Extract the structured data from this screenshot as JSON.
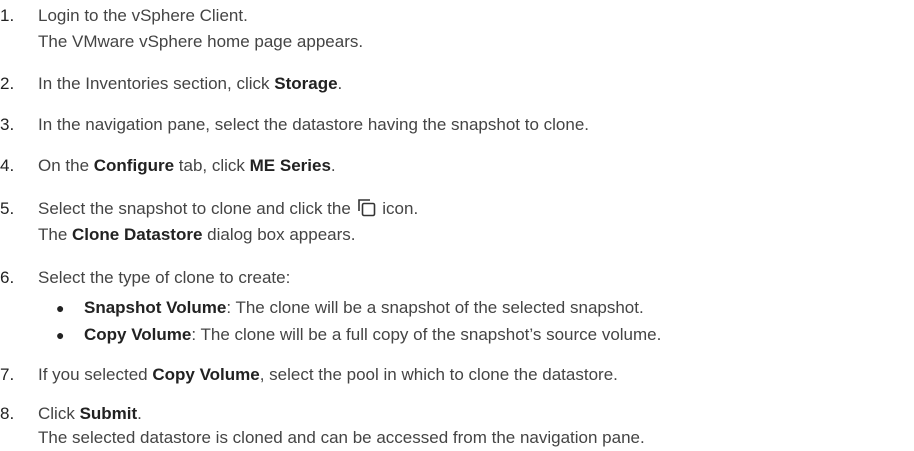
{
  "steps": [
    {
      "number": "1.",
      "text": "Login to the vSphere Client.",
      "result": "The VMware vSphere home page appears."
    },
    {
      "number": "2.",
      "prefix": "In the Inventories section, click ",
      "bold": "Storage",
      "suffix": "."
    },
    {
      "number": "3.",
      "text": "In the navigation pane, select the datastore having the snapshot to clone."
    },
    {
      "number": "4.",
      "prefix": "On the ",
      "bold1": "Configure",
      "middle": " tab, click ",
      "bold2": "ME Series",
      "suffix": "."
    },
    {
      "number": "5.",
      "prefix": "Select the snapshot to clone and click the ",
      "icon": "clone-icon",
      "suffix": " icon.",
      "result_prefix": "The ",
      "result_bold": "Clone Datastore",
      "result_suffix": " dialog box appears."
    },
    {
      "number": "6.",
      "text": "Select the type of clone to create:",
      "options": [
        {
          "bullet": "●",
          "bold": "Snapshot Volume",
          "text": ": The clone will be a snapshot of the selected snapshot."
        },
        {
          "bullet": "●",
          "bold": "Copy Volume",
          "text": ": The clone will be a full copy of the snapshot’s source volume."
        }
      ]
    },
    {
      "number": "7.",
      "prefix": "If you selected ",
      "bold": "Copy Volume",
      "suffix": ", select the pool in which to clone the datastore."
    },
    {
      "number": "8.",
      "prefix": "Click ",
      "bold": "Submit",
      "suffix": ".",
      "result": "The selected datastore is cloned and can be accessed from the navigation pane."
    }
  ],
  "colors": {
    "text": "#444444",
    "bold_text": "#222222"
  }
}
